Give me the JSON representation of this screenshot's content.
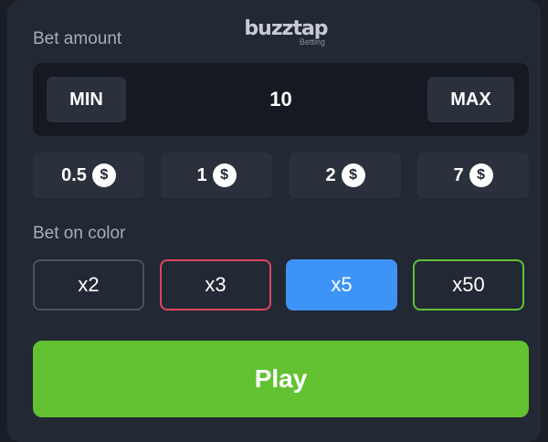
{
  "brand": {
    "name": "buzztap",
    "sub": "Betting"
  },
  "bet_amount": {
    "label": "Bet amount",
    "min_label": "MIN",
    "max_label": "MAX",
    "value": "10"
  },
  "quick_amounts": [
    {
      "value": "0.5",
      "icon": "dollar-coin-icon",
      "symbol": "$"
    },
    {
      "value": "1",
      "icon": "dollar-coin-icon",
      "symbol": "$"
    },
    {
      "value": "2",
      "icon": "dollar-coin-icon",
      "symbol": "$"
    },
    {
      "value": "7",
      "icon": "dollar-coin-icon",
      "symbol": "$"
    }
  ],
  "bet_on_color": {
    "label": "Bet on color",
    "options": [
      {
        "label": "x2",
        "color": "#4a5261",
        "fill": "#222834"
      },
      {
        "label": "x3",
        "color": "#e0445e",
        "fill": "#222834"
      },
      {
        "label": "x5",
        "color": "#3e93f7",
        "fill": "#3e93f7"
      },
      {
        "label": "x50",
        "color": "#5fc335",
        "fill": "#222834"
      }
    ]
  },
  "play": {
    "label": "Play",
    "color": "#62c232"
  }
}
